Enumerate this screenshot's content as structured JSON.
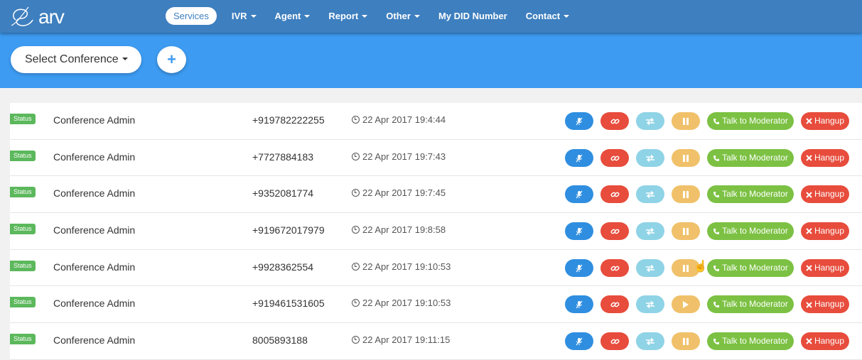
{
  "nav": {
    "logo_text": "arv",
    "items": [
      {
        "label": "Services",
        "active": true,
        "dropdown": false
      },
      {
        "label": "IVR",
        "active": false,
        "dropdown": true
      },
      {
        "label": "Agent",
        "active": false,
        "dropdown": true
      },
      {
        "label": "Report",
        "active": false,
        "dropdown": true
      },
      {
        "label": "Other",
        "active": false,
        "dropdown": true
      },
      {
        "label": "My DID Number",
        "active": false,
        "dropdown": false
      },
      {
        "label": "Contact",
        "active": false,
        "dropdown": true
      }
    ]
  },
  "toolbar": {
    "select_label": "Select Conference",
    "add_label": "+"
  },
  "actions": {
    "talk_label": "Talk to Moderator",
    "hangup_label": "Hangup"
  },
  "colors": {
    "navbar": "#3e7fbf",
    "banner": "#3d9bf1",
    "status": "#5cb85c",
    "mute": "#2f8ee0",
    "link": "#e74c3c",
    "transfer": "#8fd3e6",
    "hold": "#f0c16a",
    "talk": "#7cc143",
    "hangup": "#e74c3c"
  },
  "participants": [
    {
      "status": "Status",
      "name": "Conference Admin",
      "phone": "+919782222255",
      "time": "22 Apr 2017 19:4:44",
      "hold_icon": "pause-icon"
    },
    {
      "status": "Status",
      "name": "Conference Admin",
      "phone": "+7727884183",
      "time": "22 Apr 2017 19:7:43",
      "hold_icon": "pause-icon"
    },
    {
      "status": "Status",
      "name": "Conference Admin",
      "phone": "+9352081774",
      "time": "22 Apr 2017 19:7:45",
      "hold_icon": "pause-icon"
    },
    {
      "status": "Status",
      "name": "Conference Admin",
      "phone": "+919672017979",
      "time": "22 Apr 2017 19:8:58",
      "hold_icon": "pause-icon"
    },
    {
      "status": "Status",
      "name": "Conference Admin",
      "phone": "+9928362554",
      "time": "22 Apr 2017 19:10:53",
      "hold_icon": "pause-icon"
    },
    {
      "status": "Status",
      "name": "Conference Admin",
      "phone": "+919461531605",
      "time": "22 Apr 2017 19:10:53",
      "hold_icon": "play-icon"
    },
    {
      "status": "Status",
      "name": "Conference Admin",
      "phone": "8005893188",
      "time": "22 Apr 2017 19:11:15",
      "hold_icon": "pause-icon"
    }
  ]
}
